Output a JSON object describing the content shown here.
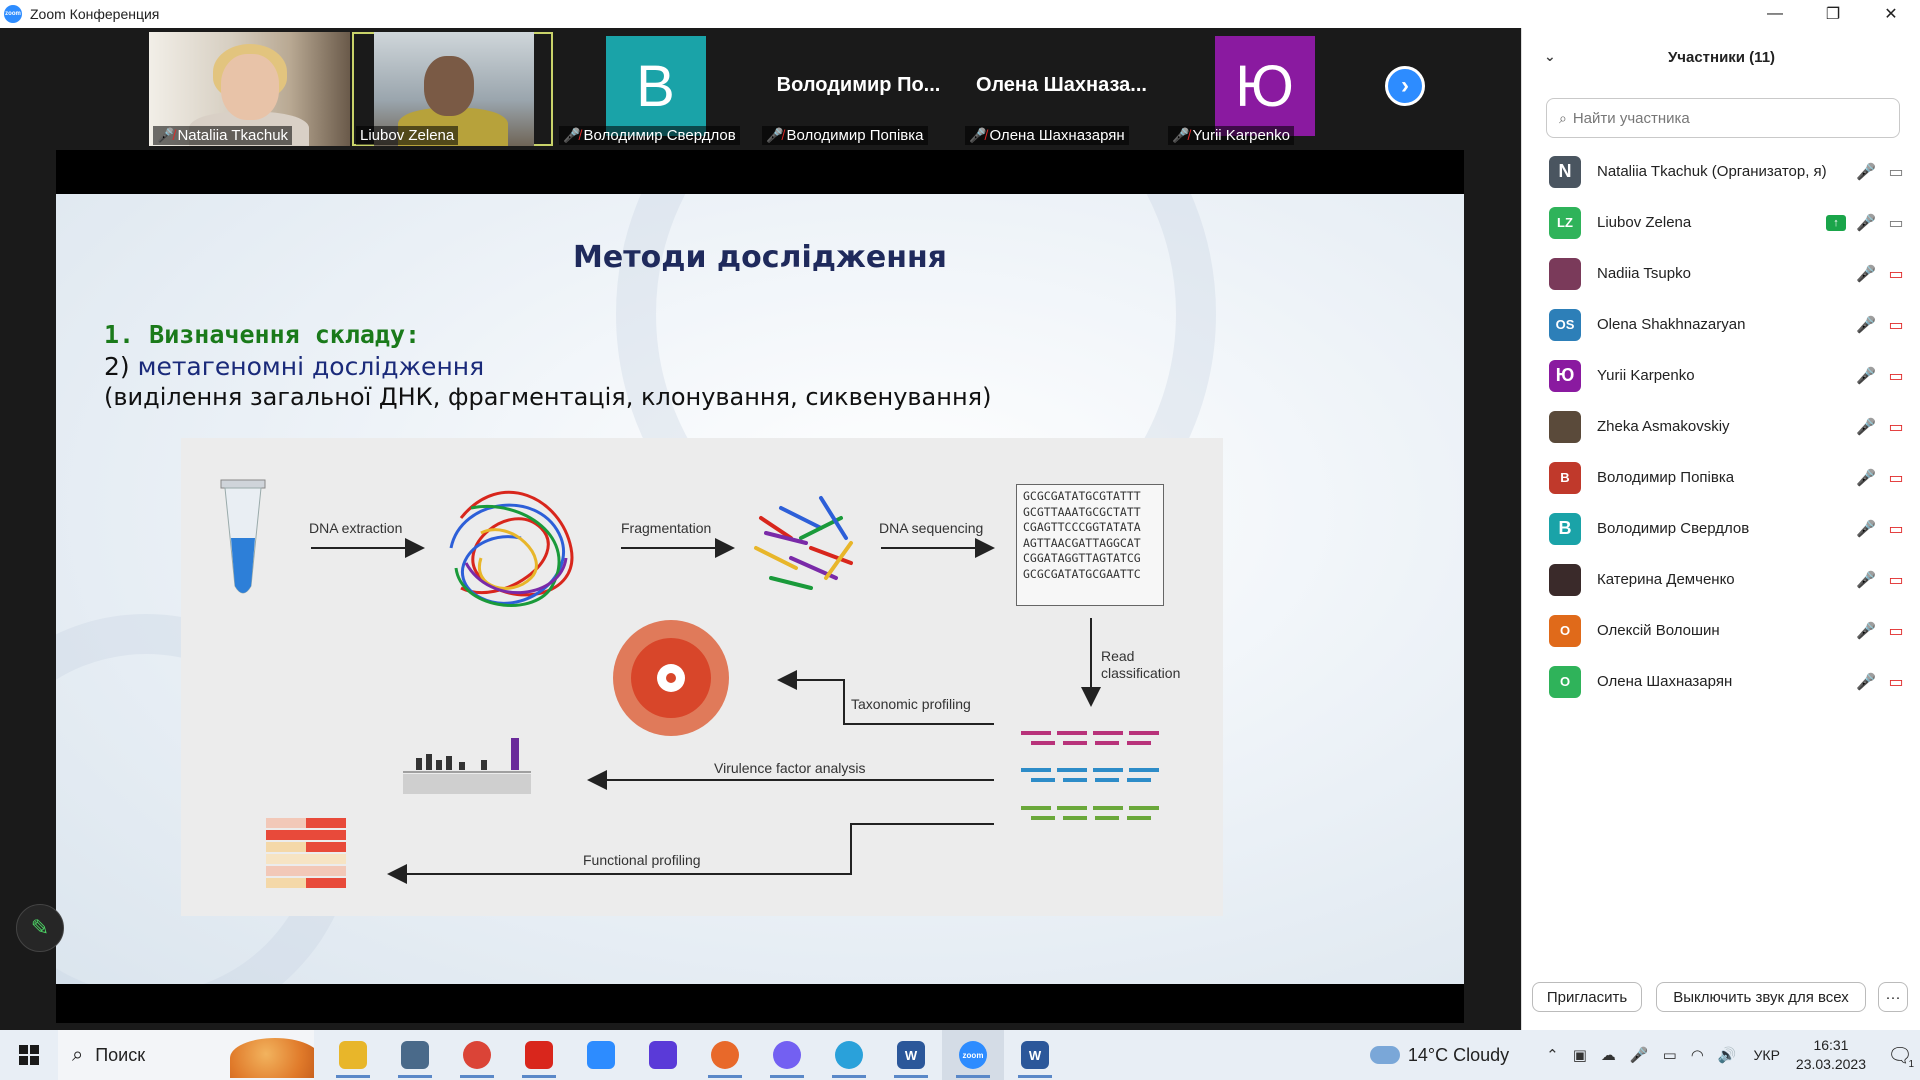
{
  "window": {
    "app_icon": "zoom",
    "title": "Zoom Конференция",
    "controls": [
      "minimize",
      "restore",
      "close"
    ]
  },
  "thumbnails": [
    {
      "name": "Nataliia Tkachuk",
      "muted": true,
      "type": "video"
    },
    {
      "name": "Liubov Zelena",
      "muted": false,
      "type": "video",
      "active": true
    },
    {
      "name": "Володимир Свердлов",
      "muted": true,
      "type": "initial",
      "initial": "В",
      "color": "#1aa3a8"
    },
    {
      "name": "Володимир Попівка",
      "muted": true,
      "type": "name",
      "big_name": "Володимир По..."
    },
    {
      "name": "Олена Шахназарян",
      "muted": true,
      "type": "name",
      "big_name": "Олена  Шахназа..."
    },
    {
      "name": "Yurii Karpenko",
      "muted": true,
      "type": "initial",
      "initial": "Ю",
      "color": "#8a1aa0"
    }
  ],
  "slide": {
    "title": "Методи дослідження",
    "line1": "1. Визначення складу:",
    "line2_num": "2)",
    "line2_text": "метагеномні дослідження",
    "line3": "(виділення загальної ДНК, фрагментація, клонування, сиквенування)",
    "figure": {
      "labels": {
        "dna_extraction": "DNA extraction",
        "fragmentation": "Fragmentation",
        "dna_sequencing": "DNA sequencing",
        "read_classification_1": "Read",
        "read_classification_2": "classification",
        "taxonomic_profiling": "Taxonomic profiling",
        "virulence": "Virulence factor analysis",
        "functional": "Functional profiling"
      },
      "sequences": [
        "GCGCGATATGCGTATTT",
        "GCGTTAAATGCGCTATT",
        "CGAGTTCCCGGTATATA",
        "AGTTAACGATTAGGCAT",
        "CGGATAGGTTAGTATCG",
        "GCGCGATATGCGAATTC"
      ]
    }
  },
  "panel": {
    "title": "Участники (11)",
    "search_placeholder": "Найти участника",
    "participants": [
      {
        "name": "Nataliia Tkachuk (Организатор, я)",
        "avatar": "N",
        "color": "#4a5560",
        "mic": "muted",
        "video": "on"
      },
      {
        "name": "Liubov Zelena",
        "avatar": "LZ",
        "color": "#2fb35a",
        "mic": "on",
        "video": "on",
        "sharing": true
      },
      {
        "name": "Nadiia Tsupko",
        "avatar": "",
        "color": "#7a3a5a",
        "mic": "muted",
        "video": "off",
        "photo": true
      },
      {
        "name": "Olena Shakhnazaryan",
        "avatar": "OS",
        "color": "#2d7fb8",
        "mic": "muted",
        "video": "off"
      },
      {
        "name": "Yurii Karpenko",
        "avatar": "Ю",
        "color": "#8a1aa0",
        "mic": "muted",
        "video": "off"
      },
      {
        "name": "Zheka Asmakovskiy",
        "avatar": "",
        "color": "#5a4a3a",
        "mic": "muted",
        "video": "off",
        "photo": true
      },
      {
        "name": "Володимир Попівка",
        "avatar": "В",
        "color": "#c0392b",
        "mic": "muted",
        "video": "off"
      },
      {
        "name": "Володимир Свердлов",
        "avatar": "В",
        "color": "#1aa3a8",
        "mic": "muted",
        "video": "off"
      },
      {
        "name": "Катерина Демченко",
        "avatar": "",
        "color": "#3a2a2a",
        "mic": "muted",
        "video": "off",
        "photo": true
      },
      {
        "name": "Олексій Волошин",
        "avatar": "О",
        "color": "#e06a1a",
        "mic": "muted",
        "video": "off"
      },
      {
        "name": "Олена Шахназарян",
        "avatar": "О",
        "color": "#2fb35a",
        "mic": "muted",
        "video": "off"
      }
    ],
    "invite_label": "Пригласить",
    "mute_all_label": "Выключить звук для всех",
    "more_label": "···"
  },
  "taskbar": {
    "search_label": "Поиск",
    "apps": [
      {
        "name": "file-explorer",
        "label": "",
        "color": "#e8b62a"
      },
      {
        "name": "unknown-app",
        "label": "",
        "color": "#4a6a8a"
      },
      {
        "name": "chrome",
        "label": "",
        "color": "#db4437"
      },
      {
        "name": "acrobat",
        "label": "",
        "color": "#d9261c"
      },
      {
        "name": "zoom-2",
        "label": "",
        "color": "#2d8cff"
      },
      {
        "name": "power-automate",
        "label": "",
        "color": "#5a3ad8"
      },
      {
        "name": "firefox",
        "label": "",
        "color": "#e8692a"
      },
      {
        "name": "viber",
        "label": "",
        "color": "#7360f2"
      },
      {
        "name": "telegram",
        "label": "",
        "color": "#2aa1da"
      },
      {
        "name": "word",
        "label": "W",
        "color": "#2b579a"
      },
      {
        "name": "zoom",
        "label": "zoom",
        "color": "#2d8cff"
      },
      {
        "name": "word-2",
        "label": "W",
        "color": "#2b579a"
      }
    ],
    "weather": "14°C  Cloudy",
    "language": "УКР",
    "time": "16:31",
    "date": "23.03.2023",
    "notifications": "1"
  }
}
